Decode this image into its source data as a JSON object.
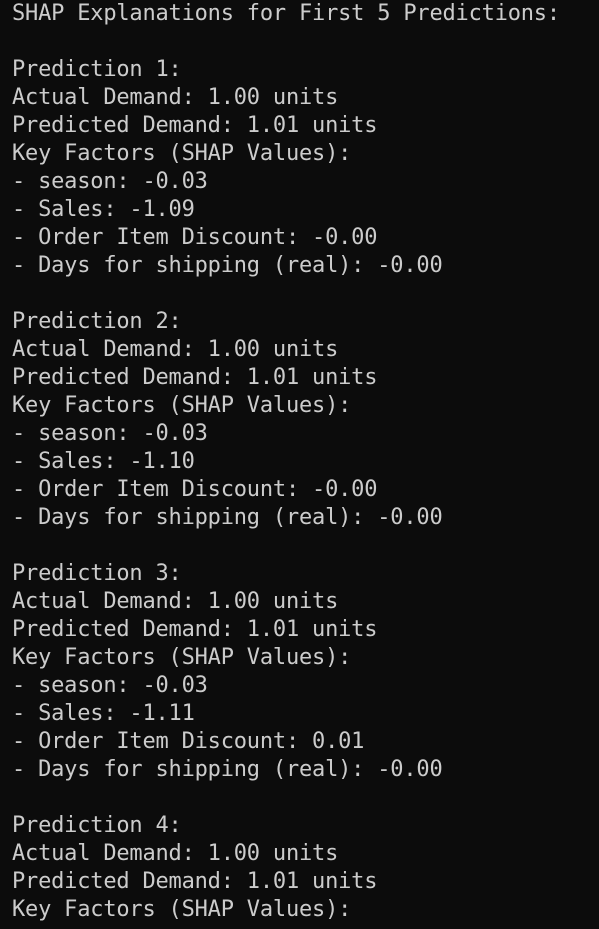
{
  "terminal": {
    "background": "#0c0c0c",
    "foreground": "#cccccc",
    "header": "SHAP Explanations for First 5 Predictions:",
    "predictions": [
      {
        "title": "Prediction 1:",
        "actual": "Actual Demand: 1.00 units",
        "predicted": "Predicted Demand: 1.01 units",
        "factors_header": "Key Factors (SHAP Values):",
        "factors": [
          "- season: -0.03",
          "- Sales: -1.09",
          "- Order Item Discount: -0.00",
          "- Days for shipping (real): -0.00"
        ]
      },
      {
        "title": "Prediction 2:",
        "actual": "Actual Demand: 1.00 units",
        "predicted": "Predicted Demand: 1.01 units",
        "factors_header": "Key Factors (SHAP Values):",
        "factors": [
          "- season: -0.03",
          "- Sales: -1.10",
          "- Order Item Discount: -0.00",
          "- Days for shipping (real): -0.00"
        ]
      },
      {
        "title": "Prediction 3:",
        "actual": "Actual Demand: 1.00 units",
        "predicted": "Predicted Demand: 1.01 units",
        "factors_header": "Key Factors (SHAP Values):",
        "factors": [
          "- season: -0.03",
          "- Sales: -1.11",
          "- Order Item Discount: 0.01",
          "- Days for shipping (real): -0.00"
        ]
      },
      {
        "title": "Prediction 4:",
        "actual": "Actual Demand: 1.00 units",
        "predicted": "Predicted Demand: 1.01 units",
        "factors_header": "Key Factors (SHAP Values):"
      }
    ]
  }
}
